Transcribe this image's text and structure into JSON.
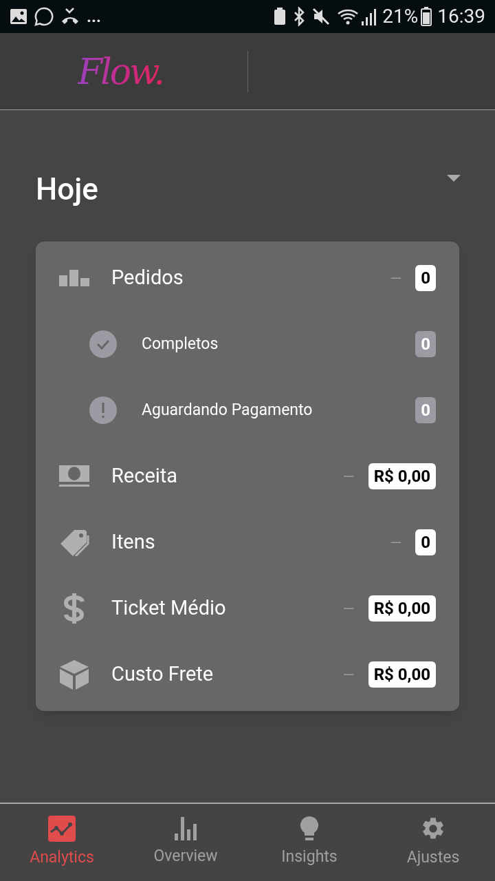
{
  "status_bar": {
    "more": "...",
    "battery": "21%",
    "time": "16:39"
  },
  "header": {
    "logo": "Flow."
  },
  "section": {
    "title": "Hoje",
    "expanded": true
  },
  "rows": [
    {
      "kind": "main",
      "label": "Pedidos",
      "trend": "—",
      "value": "0"
    },
    {
      "kind": "sub",
      "label": "Completos",
      "value": "0"
    },
    {
      "kind": "sub",
      "label": "Aguardando Pagamento",
      "value": "0"
    },
    {
      "kind": "main",
      "label": "Receita",
      "trend": "—",
      "value": "R$ 0,00"
    },
    {
      "kind": "main",
      "label": "Itens",
      "trend": "—",
      "value": "0"
    },
    {
      "kind": "main",
      "label": "Ticket Médio",
      "trend": "—",
      "value": "R$ 0,00"
    },
    {
      "kind": "main",
      "label": "Custo Frete",
      "trend": "—",
      "value": "R$ 0,00"
    }
  ],
  "bottom_nav": [
    {
      "label": "Analytics",
      "selected": true
    },
    {
      "label": "Overview",
      "selected": false
    },
    {
      "label": "Insights",
      "selected": false
    },
    {
      "label": "Ajustes",
      "selected": false
    }
  ]
}
